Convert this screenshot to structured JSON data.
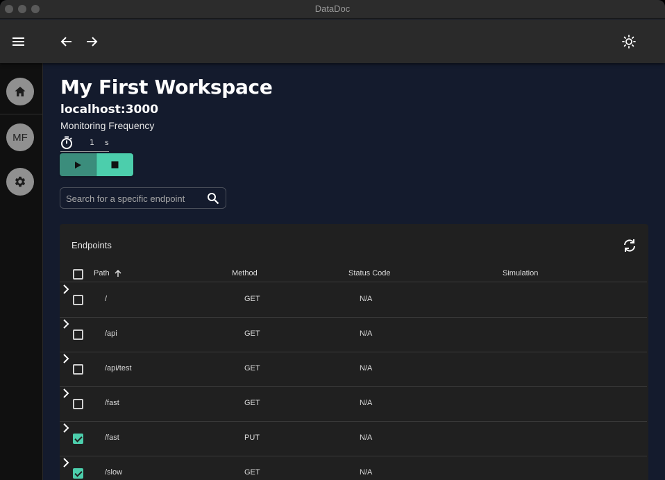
{
  "window": {
    "title": "DataDoc"
  },
  "sidebar": {
    "avatar_initials": "MF"
  },
  "workspace": {
    "name": "My First Workspace",
    "host": "localhost:3000",
    "frequency_label": "Monitoring Frequency",
    "frequency_value": "1",
    "frequency_unit": "s"
  },
  "search": {
    "placeholder": "Search for a specific endpoint"
  },
  "table": {
    "title": "Endpoints",
    "columns": {
      "path": "Path",
      "method": "Method",
      "status": "Status Code",
      "simulation": "Simulation"
    },
    "rows": [
      {
        "path": "/",
        "method": "GET",
        "status": "N/A",
        "checked": false
      },
      {
        "path": "/api",
        "method": "GET",
        "status": "N/A",
        "checked": false
      },
      {
        "path": "/api/test",
        "method": "GET",
        "status": "N/A",
        "checked": false
      },
      {
        "path": "/fast",
        "method": "GET",
        "status": "N/A",
        "checked": false
      },
      {
        "path": "/fast",
        "method": "PUT",
        "status": "N/A",
        "checked": true
      },
      {
        "path": "/slow",
        "method": "GET",
        "status": "N/A",
        "checked": true
      }
    ]
  },
  "colors": {
    "accent": "#4cceac",
    "accent_dark": "#3b8d7c",
    "background": "#141b2d",
    "card": "#202020"
  }
}
